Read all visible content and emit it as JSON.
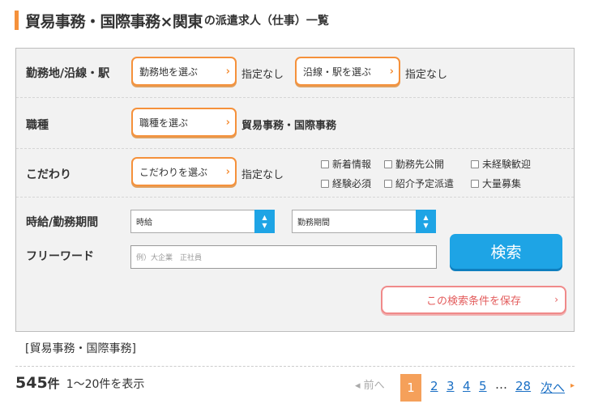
{
  "header": {
    "title_main": "貿易事務・国際事務×関東",
    "title_sub": "の派遣求人（仕事）一覧"
  },
  "search": {
    "location": {
      "label": "勤務地/沿線・駅",
      "area_button": "勤務地を選ぶ",
      "area_value": "指定なし",
      "line_button": "沿線・駅を選ぶ",
      "line_value": "指定なし"
    },
    "job_type": {
      "label": "職種",
      "button": "職種を選ぶ",
      "value": "貿易事務・国際事務"
    },
    "preference": {
      "label": "こだわり",
      "button": "こだわりを選ぶ",
      "value": "指定なし",
      "checkboxes": [
        "新着情報",
        "勤務先公開",
        "未経験歓迎",
        "経験必須",
        "紹介予定派遣",
        "大量募集"
      ]
    },
    "wage": {
      "label": "時給/勤務期間",
      "wage_select": "時給",
      "period_select": "勤務期間"
    },
    "freeword": {
      "label": "フリーワード",
      "placeholder": "例）大企業　正社員"
    },
    "search_button": "検索",
    "save_button": "この検索条件を保存"
  },
  "selected_tag": "[貿易事務・国際事務]",
  "results": {
    "count": "545",
    "unit": "件",
    "range": "1〜20件を表示"
  },
  "pagination": {
    "prev": "◂ 前へ",
    "current": "1",
    "pages": [
      "2",
      "3",
      "4",
      "5"
    ],
    "ellipsis": "…",
    "last": "28",
    "next": "次へ",
    "next_arrow": "▸"
  },
  "colors": {
    "accent_orange": "#f5913b",
    "button_blue": "#1ea4e5",
    "link_blue": "#1a6fc4",
    "save_pink": "#e35c5c"
  }
}
